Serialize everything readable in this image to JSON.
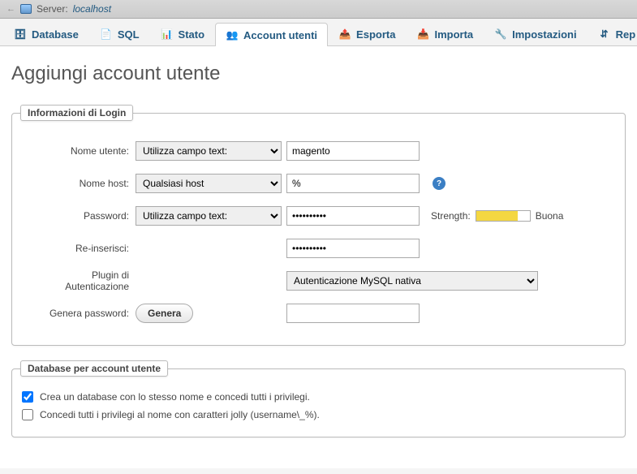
{
  "breadcrumb": {
    "server_label": "Server:",
    "server_name": "localhost"
  },
  "tabs": {
    "database": "Database",
    "sql": "SQL",
    "stato": "Stato",
    "account": "Account utenti",
    "esporta": "Esporta",
    "importa": "Importa",
    "impostazioni": "Impostazioni",
    "rep": "Rep"
  },
  "page_title": "Aggiungi account utente",
  "login": {
    "legend": "Informazioni di Login",
    "username_label": "Nome utente:",
    "username_select": "Utilizza campo text:",
    "username_value": "magento",
    "host_label": "Nome host:",
    "host_select": "Qualsiasi host",
    "host_value": "%",
    "password_label": "Password:",
    "password_select": "Utilizza campo text:",
    "password_value": "••••••••••",
    "strength_label": "Strength:",
    "strength_text": "Buona",
    "retype_label": "Re-inserisci:",
    "retype_value": "••••••••••",
    "auth_plugin_label_1": "Plugin di",
    "auth_plugin_label_2": "Autenticazione",
    "auth_plugin_select": "Autenticazione MySQL nativa",
    "gen_label": "Genera password:",
    "gen_button": "Genera"
  },
  "dbsection": {
    "legend": "Database per account utente",
    "create_db": "Crea un database con lo stesso nome e concedi tutti i privilegi.",
    "wildcard": "Concedi tutti i privilegi al nome con caratteri jolly (username\\_%)."
  }
}
